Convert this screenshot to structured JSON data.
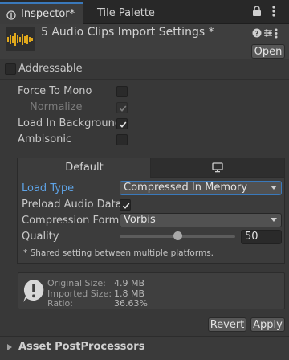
{
  "tabs": {
    "inspector": "Inspector*",
    "tile_palette": "Tile Palette"
  },
  "header": {
    "title": "5 Audio Clips Import Settings *",
    "open_label": "Open"
  },
  "addressable": {
    "label": "Addressable",
    "checked": false
  },
  "options": {
    "force_to_mono": {
      "label": "Force To Mono",
      "checked": false
    },
    "normalize": {
      "label": "Normalize",
      "checked": true
    },
    "load_in_background": {
      "label": "Load In Background",
      "checked": true
    },
    "ambisonic": {
      "label": "Ambisonic",
      "checked": false
    }
  },
  "platform_tabs": {
    "default_label": "Default",
    "pc_icon": "monitor-icon"
  },
  "platform_settings": {
    "load_type": {
      "label": "Load Type",
      "value": "Compressed In Memory"
    },
    "preload_audio_data": {
      "label": "Preload Audio Data*",
      "checked": true
    },
    "compression_format": {
      "label": "Compression Format",
      "value": "Vorbis"
    },
    "quality": {
      "label": "Quality",
      "value": "50",
      "fraction": 0.5
    },
    "shared_note": "* Shared setting between multiple platforms."
  },
  "info": {
    "original_size_label": "Original Size:",
    "original_size_value": "4.9 MB",
    "imported_size_label": "Imported Size:",
    "imported_size_value": "1.8 MB",
    "ratio_label": "Ratio:",
    "ratio_value": "36.63%"
  },
  "buttons": {
    "revert": "Revert",
    "apply": "Apply"
  },
  "asset_postprocessors": {
    "label": "Asset PostProcessors"
  },
  "colors": {
    "accent": "#3a79bb",
    "label_blue": "#5ea3e6",
    "background": "#383838",
    "waveform_icon": "#e0a81c"
  }
}
